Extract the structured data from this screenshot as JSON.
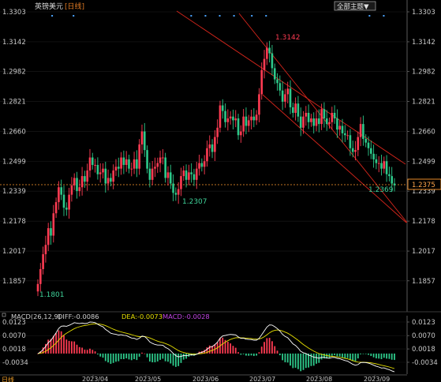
{
  "header": {
    "instrument": "英镑美元",
    "period": "[日线]",
    "dropdown_label": "全部主题▼"
  },
  "price_axis": {
    "ticks": [
      "1.3303",
      "1.3142",
      "1.2982",
      "1.2821",
      "1.2660",
      "1.2499",
      "1.2339",
      "1.2178",
      "1.2017",
      "1.1857"
    ],
    "last_price_label": "1.2375"
  },
  "annotations": {
    "high": "1.3142",
    "mid_low": "1.2307",
    "end_low": "1.2369",
    "start_low": "1.1801"
  },
  "macd_header": {
    "params": "MACD(26,12,9)",
    "diff": "DIFF:-0.0086",
    "dea": "DEA:-0.0073",
    "macd": "MACD:-0.0028"
  },
  "macd_axis": {
    "ticks": [
      "0.0123",
      "0.0070",
      "0.0018",
      "-0.0034"
    ]
  },
  "date_axis": {
    "labels": [
      "2023/04",
      "2023/05",
      "2023/06",
      "2023/07",
      "2023/08",
      "2023/09"
    ]
  },
  "bottom_left_label": "日线",
  "colors": {
    "up": "#ff3b52",
    "down": "#2dc98a",
    "channel": "#d9261c",
    "last_price": "#ff9a2e",
    "dea": "#e6df00",
    "macd": "#c445e6"
  },
  "chart_data": {
    "type": "candlestick",
    "instrument": "英镑美元",
    "period": "[日线]",
    "dates": [
      "2023/04",
      "2023/05",
      "2023/06",
      "2023/07",
      "2023/08",
      "2023/09"
    ],
    "price_ylim": [
      1.1801,
      1.3303
    ],
    "annotated_extremes": {
      "high": 1.3142,
      "mid_low": 1.2307,
      "end_low": 1.2369,
      "start_low": 1.1801
    },
    "last_close": 1.2375,
    "closes": [
      1.184,
      1.192,
      1.2,
      1.205,
      1.214,
      1.21,
      1.222,
      1.228,
      1.236,
      1.232,
      1.225,
      1.224,
      1.232,
      1.237,
      1.241,
      1.234,
      1.236,
      1.242,
      1.239,
      1.245,
      1.252,
      1.248,
      1.248,
      1.243,
      1.244,
      1.246,
      1.238,
      1.241,
      1.239,
      1.245,
      1.247,
      1.246,
      1.252,
      1.248,
      1.251,
      1.246,
      1.246,
      1.251,
      1.246,
      1.259,
      1.266,
      1.256,
      1.246,
      1.24,
      1.246,
      1.247,
      1.249,
      1.252,
      1.252,
      1.241,
      1.244,
      1.238,
      1.233,
      1.232,
      1.235,
      1.242,
      1.245,
      1.24,
      1.244,
      1.243,
      1.24,
      1.246,
      1.249,
      1.247,
      1.25,
      1.257,
      1.259,
      1.255,
      1.263,
      1.268,
      1.28,
      1.277,
      1.271,
      1.273,
      1.274,
      1.272,
      1.273,
      1.264,
      1.266,
      1.274,
      1.269,
      1.272,
      1.274,
      1.272,
      1.275,
      1.286,
      1.299,
      1.305,
      1.311,
      1.308,
      1.3,
      1.294,
      1.292,
      1.288,
      1.282,
      1.286,
      1.289,
      1.279,
      1.276,
      1.281,
      1.274,
      1.268,
      1.274,
      1.276,
      1.271,
      1.273,
      1.269,
      1.273,
      1.27,
      1.278,
      1.273,
      1.27,
      1.271,
      1.276,
      1.273,
      1.267,
      1.269,
      1.265,
      1.264,
      1.264,
      1.257,
      1.255,
      1.256,
      1.263,
      1.27,
      1.262,
      1.26,
      1.257,
      1.254,
      1.251,
      1.249,
      1.249,
      1.246,
      1.25,
      1.243,
      1.242,
      1.238,
      1.237
    ],
    "macd": {
      "params": "MACD(26,12,9)",
      "diff": -0.0086,
      "dea": -0.0073,
      "macd": -0.0028,
      "ylim": [
        -0.0034,
        0.0123
      ]
    }
  }
}
